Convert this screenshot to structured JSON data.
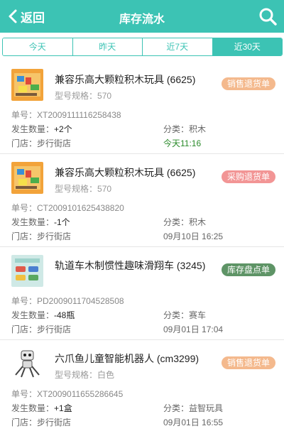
{
  "header": {
    "back_label": "返回",
    "title": "库存流水"
  },
  "tabs": [
    {
      "label": "今天",
      "active": false
    },
    {
      "label": "昨天",
      "active": false
    },
    {
      "label": "近7天",
      "active": false
    },
    {
      "label": "近30天",
      "active": true
    }
  ],
  "records": [
    {
      "name": "兼容乐高大颗粒积木玩具 (6625)",
      "spec_label": "型号规格：",
      "spec": "570",
      "badge": "销售退货单",
      "badge_color": "#f4b98d",
      "order_label": "单号：",
      "order_no": "XT2009111116258438",
      "qty_label": "发生数量：",
      "qty": "+2个",
      "category_label": "分类：",
      "category": "积木",
      "store_label": "门店：",
      "store": "步行街店",
      "time": "今天11:16"
    },
    {
      "name": "兼容乐高大颗粒积木玩具 (6625)",
      "spec_label": "型号规格：",
      "spec": "570",
      "badge": "采购退货单",
      "badge_color": "#f29595",
      "order_label": "单号：",
      "order_no": "CT2009101625438820",
      "qty_label": "发生数量：",
      "qty": "-1个",
      "category_label": "分类：",
      "category": "积木",
      "store_label": "门店：",
      "store": "步行街店",
      "time": "09月10日 16:25"
    },
    {
      "name": "轨道车木制惯性趣味滑翔车 (3245)",
      "spec_label": "",
      "spec": "",
      "badge": "库存盘点单",
      "badge_color": "#5e9466",
      "order_label": "单号：",
      "order_no": "PD2009011704528508",
      "qty_label": "发生数量：",
      "qty": "-48瓶",
      "category_label": "分类：",
      "category": "赛车",
      "store_label": "门店：",
      "store": "步行街店",
      "time": "09月01日 17:04"
    },
    {
      "name": "六爪鱼儿童智能机器人 (cm3299)",
      "spec_label": "型号规格：",
      "spec": "白色",
      "badge": "销售退货单",
      "badge_color": "#f4b98d",
      "order_label": "单号：",
      "order_no": "XT2009011655286645",
      "qty_label": "发生数量：",
      "qty": "+1盒",
      "category_label": "分类：",
      "category": "益智玩具",
      "store_label": "门店：",
      "store": "步行街店",
      "time": "09月01日 16:55"
    }
  ]
}
